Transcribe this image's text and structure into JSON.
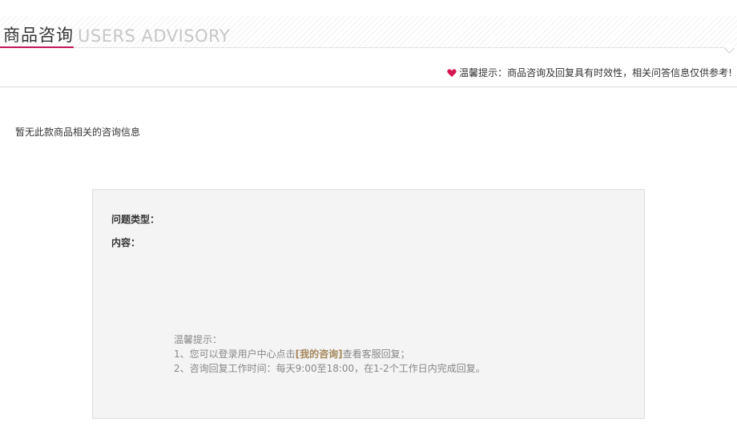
{
  "header": {
    "title_cn": "商品咨询",
    "title_en": "USERS ADVISORY",
    "accent_color": "#c2185b"
  },
  "tip": {
    "icon": "heart-icon",
    "text": "温馨提示：商品咨询及回复具有时效性，相关问答信息仅供参考!"
  },
  "empty_message": "暂无此款商品相关的咨询信息",
  "form": {
    "type_label": "问题类型：",
    "content_label": "内容："
  },
  "notice": {
    "heading": "温馨提示：",
    "line1_prefix": "1、您可以登录用户中心点击",
    "line1_link": "[我的咨询]",
    "line1_suffix": "查看客服回复；",
    "line2": "2、咨询回复工作时间：每天9:00至18:00，在1-2个工作日内完成回复。",
    "link_color": "#a4875a"
  }
}
